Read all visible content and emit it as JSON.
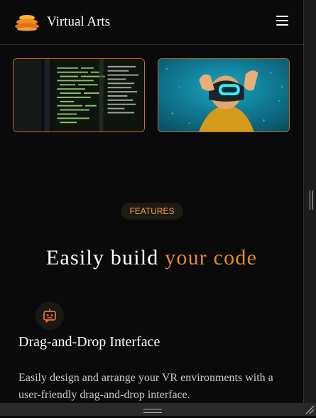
{
  "header": {
    "brand": "Virtual Arts",
    "logo_icon": "layered-orange-disc-icon",
    "menu_icon": "hamburger-menu-icon"
  },
  "hero": {
    "images": [
      {
        "subject": "code-on-screen-image"
      },
      {
        "subject": "vr-headset-person-image"
      }
    ],
    "border_color": "#c2701f"
  },
  "features_section": {
    "badge": "FEATURES",
    "heading_plain": "Easily build ",
    "heading_accent": "your code",
    "accent_color": "#e68a25",
    "items": [
      {
        "icon": "robot-icon",
        "title": "Drag-and-Drop Interface",
        "description": "Easily design and arrange your VR environments with a user-friendly drag-and-drop interface."
      }
    ]
  }
}
